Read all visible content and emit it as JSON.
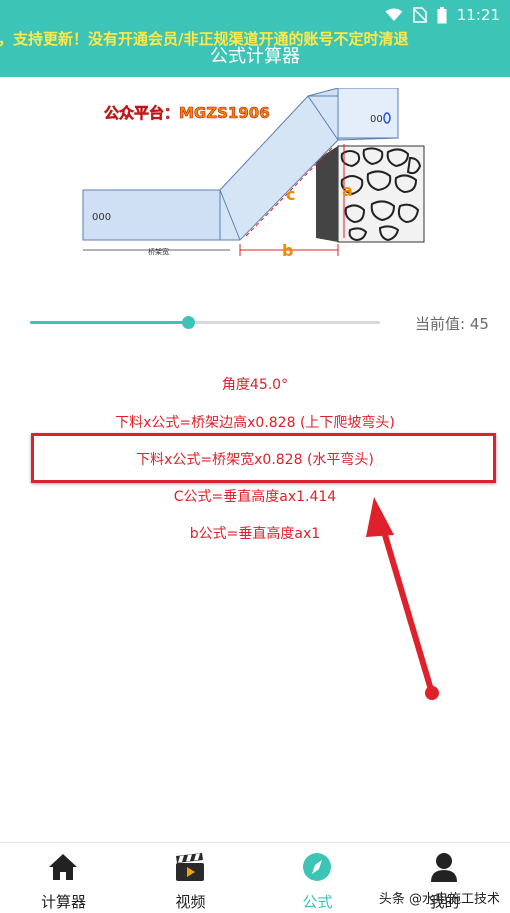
{
  "status": {
    "time": "11:21"
  },
  "header": {
    "ticker": "，支持更新！没有开通会员/非正规渠道开通的账号不定时清退",
    "title": "公式计算器"
  },
  "diagram": {
    "watermark": "公众平台：MGZS1906",
    "label_c": "c",
    "label_a": "a",
    "label_b": "b",
    "bottom_text": "桥架宽"
  },
  "slider": {
    "value_text": "当前值: 45",
    "fraction": 0.45
  },
  "formulas": [
    "角度45.0°",
    "下料x公式=桥架边高x0.828 (上下爬坡弯头)",
    "下料x公式=桥架宽x0.828 (水平弯头)",
    "C公式=垂直高度ax1.414",
    "b公式=垂直高度ax1"
  ],
  "nav": {
    "items": [
      {
        "label": "计算器",
        "icon": "home-icon"
      },
      {
        "label": "视频",
        "icon": "clapperboard-icon"
      },
      {
        "label": "公式",
        "icon": "compass-icon"
      },
      {
        "label": "我的",
        "icon": "person-icon"
      }
    ]
  },
  "watermark": "头条 @水电施工技术",
  "colors": {
    "accent": "#3cc4b6",
    "formula": "#e0202a",
    "ticker": "#ffe84a"
  }
}
